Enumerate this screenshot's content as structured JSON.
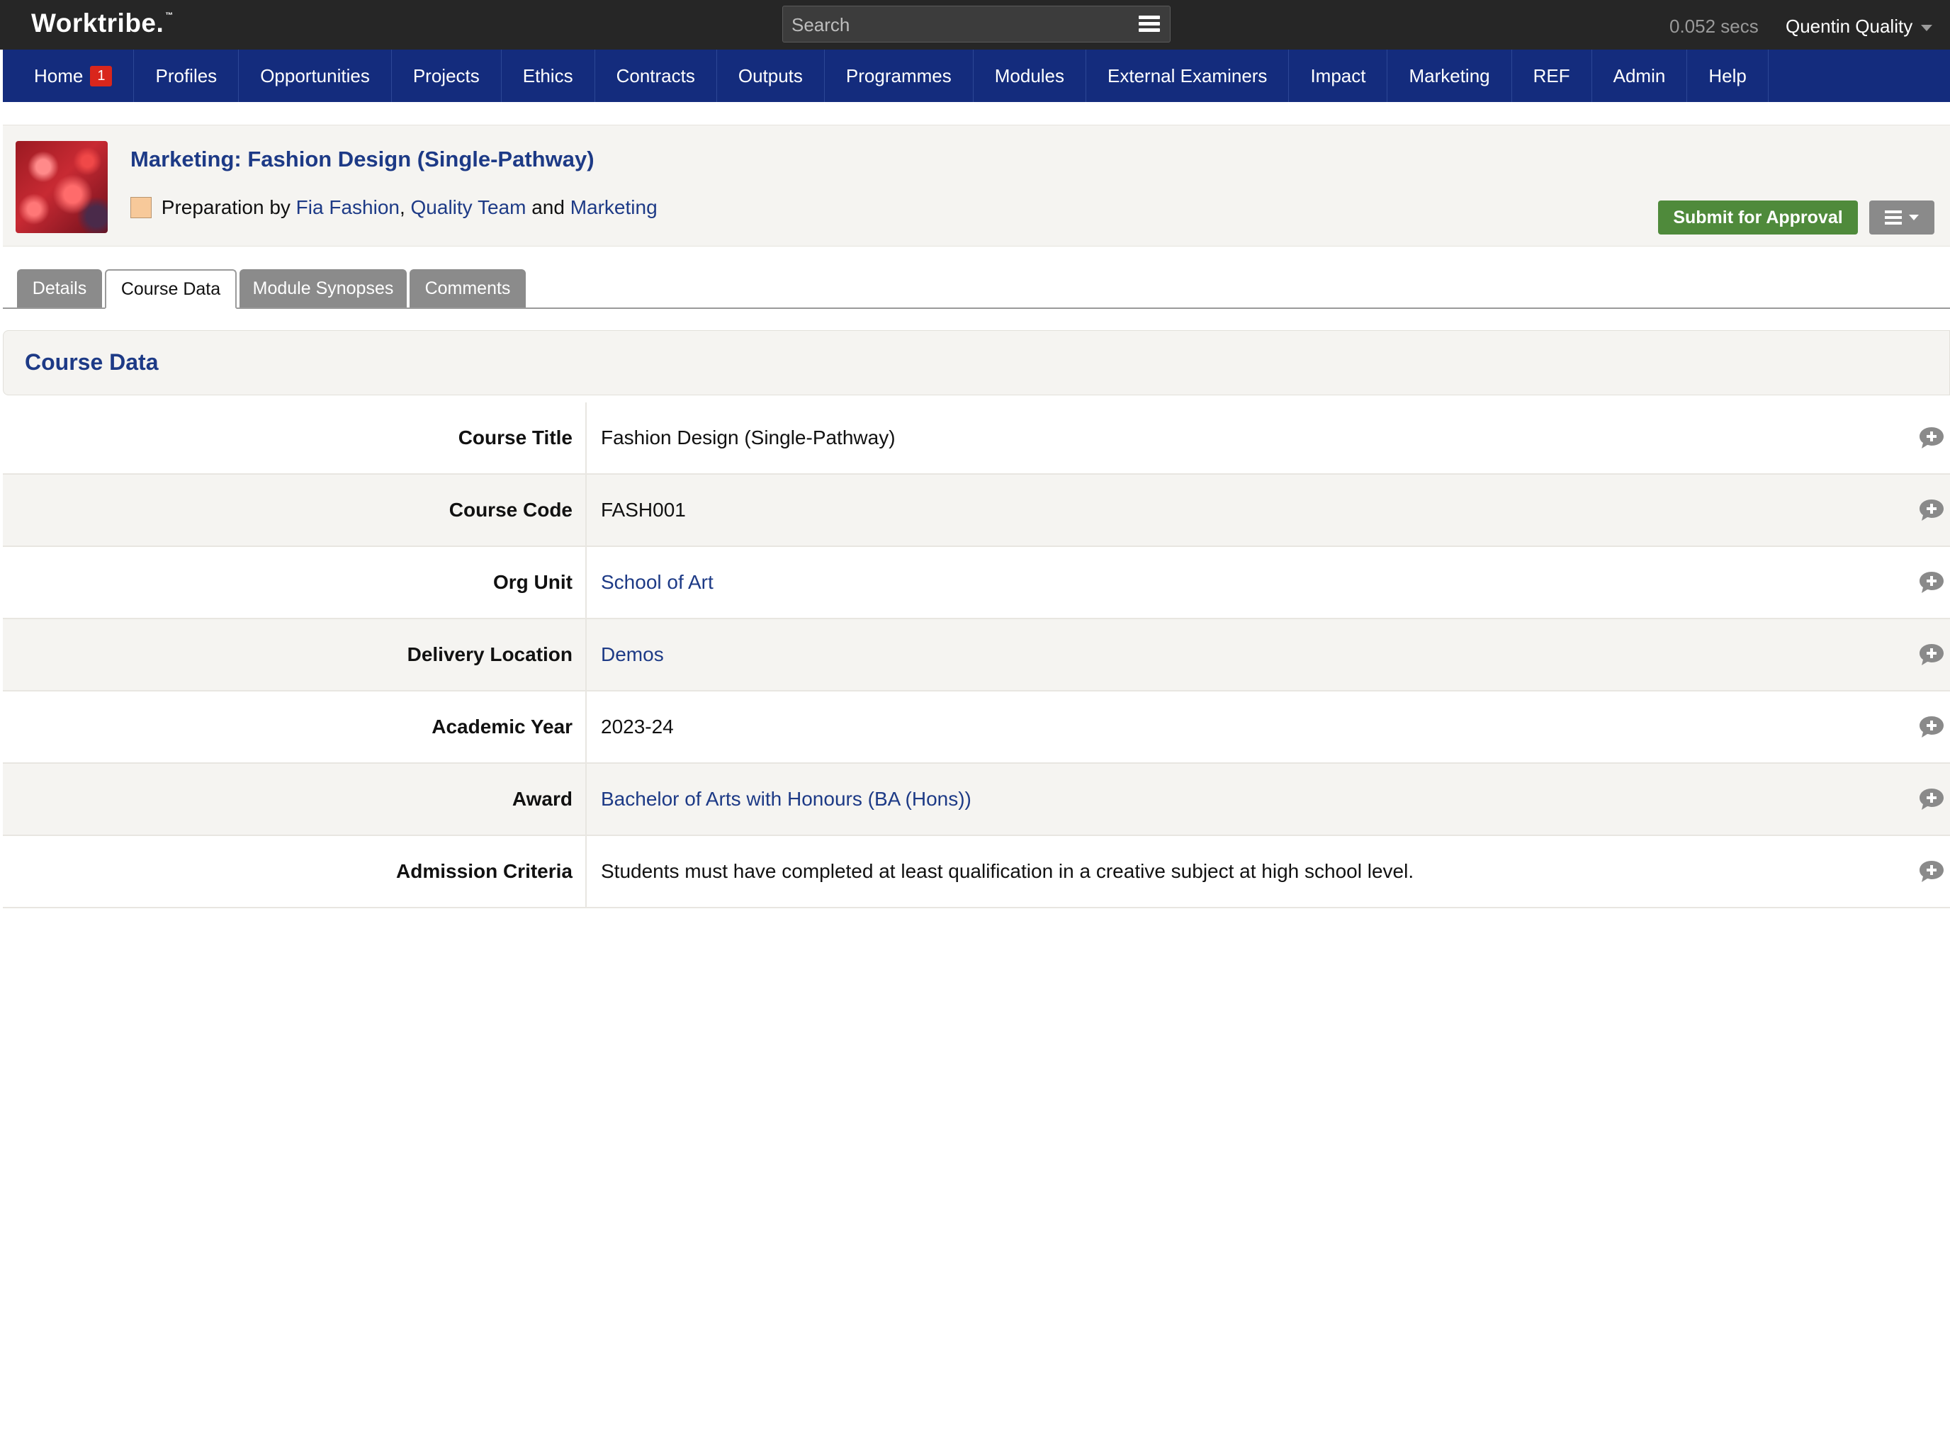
{
  "app": {
    "logo": "Worktribe.",
    "logo_tm": "™",
    "search_placeholder": "Search",
    "timer": "0.052 secs",
    "user": "Quentin Quality"
  },
  "nav": {
    "items": [
      {
        "label": "Home",
        "badge": "1"
      },
      {
        "label": "Profiles"
      },
      {
        "label": "Opportunities"
      },
      {
        "label": "Projects"
      },
      {
        "label": "Ethics"
      },
      {
        "label": "Contracts"
      },
      {
        "label": "Outputs"
      },
      {
        "label": "Programmes"
      },
      {
        "label": "Modules"
      },
      {
        "label": "External Examiners"
      },
      {
        "label": "Impact"
      },
      {
        "label": "Marketing"
      },
      {
        "label": "REF"
      },
      {
        "label": "Admin"
      },
      {
        "label": "Help"
      }
    ]
  },
  "item": {
    "title": "Marketing: Fashion Design (Single-Pathway)",
    "status_prefix": "Preparation by",
    "owner1": "Fia Fashion",
    "sep1": ",",
    "owner2": "Quality Team",
    "and": "and",
    "owner3": "Marketing",
    "status_color": "#f7c99a",
    "submit_label": "Submit for Approval"
  },
  "tabs": [
    {
      "label": "Details",
      "active": false
    },
    {
      "label": "Course Data",
      "active": true
    },
    {
      "label": "Module Synopses",
      "active": false
    },
    {
      "label": "Comments",
      "active": false
    }
  ],
  "section": {
    "title": "Course Data"
  },
  "rows": [
    {
      "label": "Course Title",
      "value": "Fashion Design (Single-Pathway)",
      "link": false
    },
    {
      "label": "Course Code",
      "value": "FASH001",
      "link": false
    },
    {
      "label": "Org Unit",
      "value": "School of Art",
      "link": true
    },
    {
      "label": "Delivery Location",
      "value": "Demos",
      "link": true
    },
    {
      "label": "Academic Year",
      "value": "2023-24",
      "link": false
    },
    {
      "label": "Award",
      "value": "Bachelor of Arts with Honours (BA (Hons))",
      "link": true
    },
    {
      "label": "Admission Criteria",
      "value": "Students must have completed at least qualification in a creative subject at high school level.",
      "link": false
    }
  ],
  "colors": {
    "topbar": "#262626",
    "navbar": "#142c7d",
    "link": "#1d3a86",
    "submit": "#4f8a3b",
    "badge": "#d9261c"
  },
  "icons": {
    "menu": "hamburger-icon",
    "comment": "add-comment-icon",
    "caret": "chevron-down-icon"
  }
}
